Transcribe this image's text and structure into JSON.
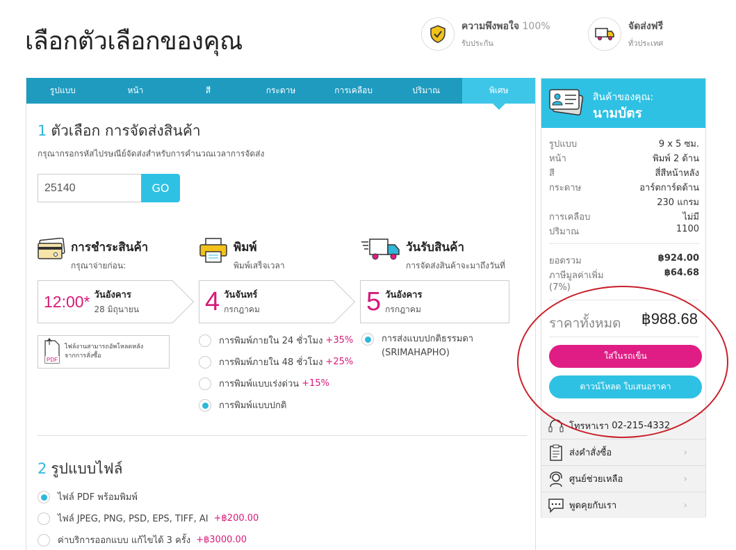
{
  "page": {
    "title": "เลือกตัวเลือกของคุณ"
  },
  "badges": [
    {
      "title": "ความพึงพอใจ",
      "title_light": "100%",
      "subtitle": "รับประกัน"
    },
    {
      "title": "จัดส่งฟรี",
      "title_light": "",
      "subtitle": "ทั่วประเทศ"
    }
  ],
  "tabs": [
    "รูปแบบ",
    "หน้า",
    "สี",
    "กระดาษ",
    "การเคลือบ",
    "ปริมาณ",
    "พิเศษ"
  ],
  "delivery": {
    "number": "1",
    "title": "ตัวเลือก การจัดส่งสินค้า",
    "hint": "กรุณากรอกรหัสไปรษณีย์จัดส่งสำหรับการคำนวณเวลาการจัดส่ง",
    "zip_value": "25140",
    "go_label": "GO",
    "payment": {
      "title": "การชำระสินค้า",
      "subtitle": "กรุณาจ่ายก่อน:",
      "big": "12:00*",
      "day": "วันอังคาร",
      "date": "28 มิถุนายน"
    },
    "print": {
      "title": "พิมพ์",
      "subtitle": "พิมพ์เสร็จเวลา",
      "big": "4",
      "day": "วันจันทร์",
      "date": "กรกฎาคม"
    },
    "receive": {
      "title": "วันรับสินค้า",
      "subtitle": "การจัดส่งสินค้าจะมาถึงวันที่",
      "big": "5",
      "day": "วันอังคาร",
      "date": "กรกฎาคม"
    },
    "upload_note_1": "ไฟล์งานสามารถอัพโหลดหลัง",
    "upload_note_2": "จากการสั่งซื้อ",
    "pdf_label": "PDF",
    "print_options": [
      {
        "label": "การพิมพ์ภายใน 24 ชั่วโมง",
        "extra": "+35%"
      },
      {
        "label": "การพิมพ์ภายใน 48 ชั่วโมง",
        "extra": "+25%"
      },
      {
        "label": "การพิมพ์แบบเร่งด่วน",
        "extra": "+15%"
      },
      {
        "label": "การพิมพ์แบบปกติ",
        "extra": ""
      }
    ],
    "shipping_option_1": "การส่งแบบปกติธรรมดา",
    "shipping_option_2": "(SRIMAHAPHO)"
  },
  "file_format": {
    "number": "2",
    "title": "รูปแบบไฟล์",
    "options": [
      {
        "label": "ไฟล์ PDF พร้อมพิมพ์",
        "extra": ""
      },
      {
        "label": "ไฟล์ JPEG, PNG, PSD, EPS, TIFF, AI",
        "extra": "+฿200.00"
      },
      {
        "label": "ค่าบริการออกแบบ แก้ไขได้ 3 ครั้ง",
        "extra": "+฿3000.00"
      }
    ]
  },
  "summary": {
    "label": "สินค้าของคุณ:",
    "product": "นามบัตร",
    "specs": [
      {
        "k": "รูปแบบ",
        "v": "9 x 5 ซม."
      },
      {
        "k": "หน้า",
        "v": "พิมพ์ 2 ด้าน"
      },
      {
        "k": "สี",
        "v": "สี่สีหน้าหลัง"
      },
      {
        "k": "กระดาษ",
        "v": "อาร์ตการ์ดด้าน"
      },
      {
        "k": "",
        "v": "230 แกรม"
      },
      {
        "k": "การเคลือบ",
        "v": "ไม่มี"
      },
      {
        "k": "ปริมาณ",
        "v": "1100"
      }
    ],
    "subtotal_label": "ยอดรวม",
    "subtotal": "฿924.00",
    "vat_label": "ภาษีมูลค่าเพิ่ม",
    "vat_rate": "(7%)",
    "vat": "฿64.68",
    "total_label": "ราคาทั้งหมด",
    "total": "฿988.68",
    "add_to_cart": "ใส่ในรถเข็น",
    "download_quote": "ดาวน์โหลด ใบเสนอราคา"
  },
  "side_links": [
    {
      "label": "โทรหาเรา",
      "value": "02-215-4332"
    },
    {
      "label": "ส่งคำสั่งซื้อ"
    },
    {
      "label": "ศูนย์ช่วยเหลือ"
    },
    {
      "label": "พูดคุยกับเรา"
    }
  ],
  "colors": {
    "primary": "#1f9bc0",
    "accent": "#2fc1e4",
    "pink": "#e01d84",
    "annotation": "#c8202a"
  }
}
